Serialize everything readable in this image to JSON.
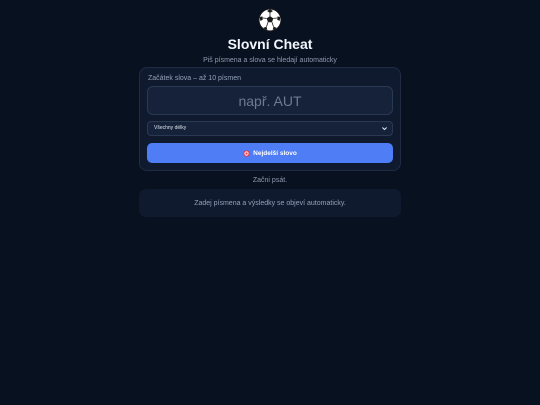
{
  "app": {
    "logo_icon": "soccer-ball-icon",
    "title": "Slovní Cheat",
    "subtitle": "Piš písmena a slova se hledají automaticky"
  },
  "form": {
    "field_label": "Začátek slova – až 10 písmen",
    "word_input": {
      "value": "",
      "placeholder": "např. AUT"
    },
    "length_select": {
      "selected": "Všechny délky"
    },
    "longest_button": {
      "icon": "target-icon",
      "label": "Nejdelší slovo"
    }
  },
  "status": {
    "text": "Začni psát."
  },
  "results": {
    "message": "Zadej písmena a výsledky se objeví automaticky."
  },
  "colors": {
    "background": "#081120",
    "card": "#0f1a2e",
    "accent": "#4f7df6",
    "text_muted": "#8d9ab0"
  }
}
